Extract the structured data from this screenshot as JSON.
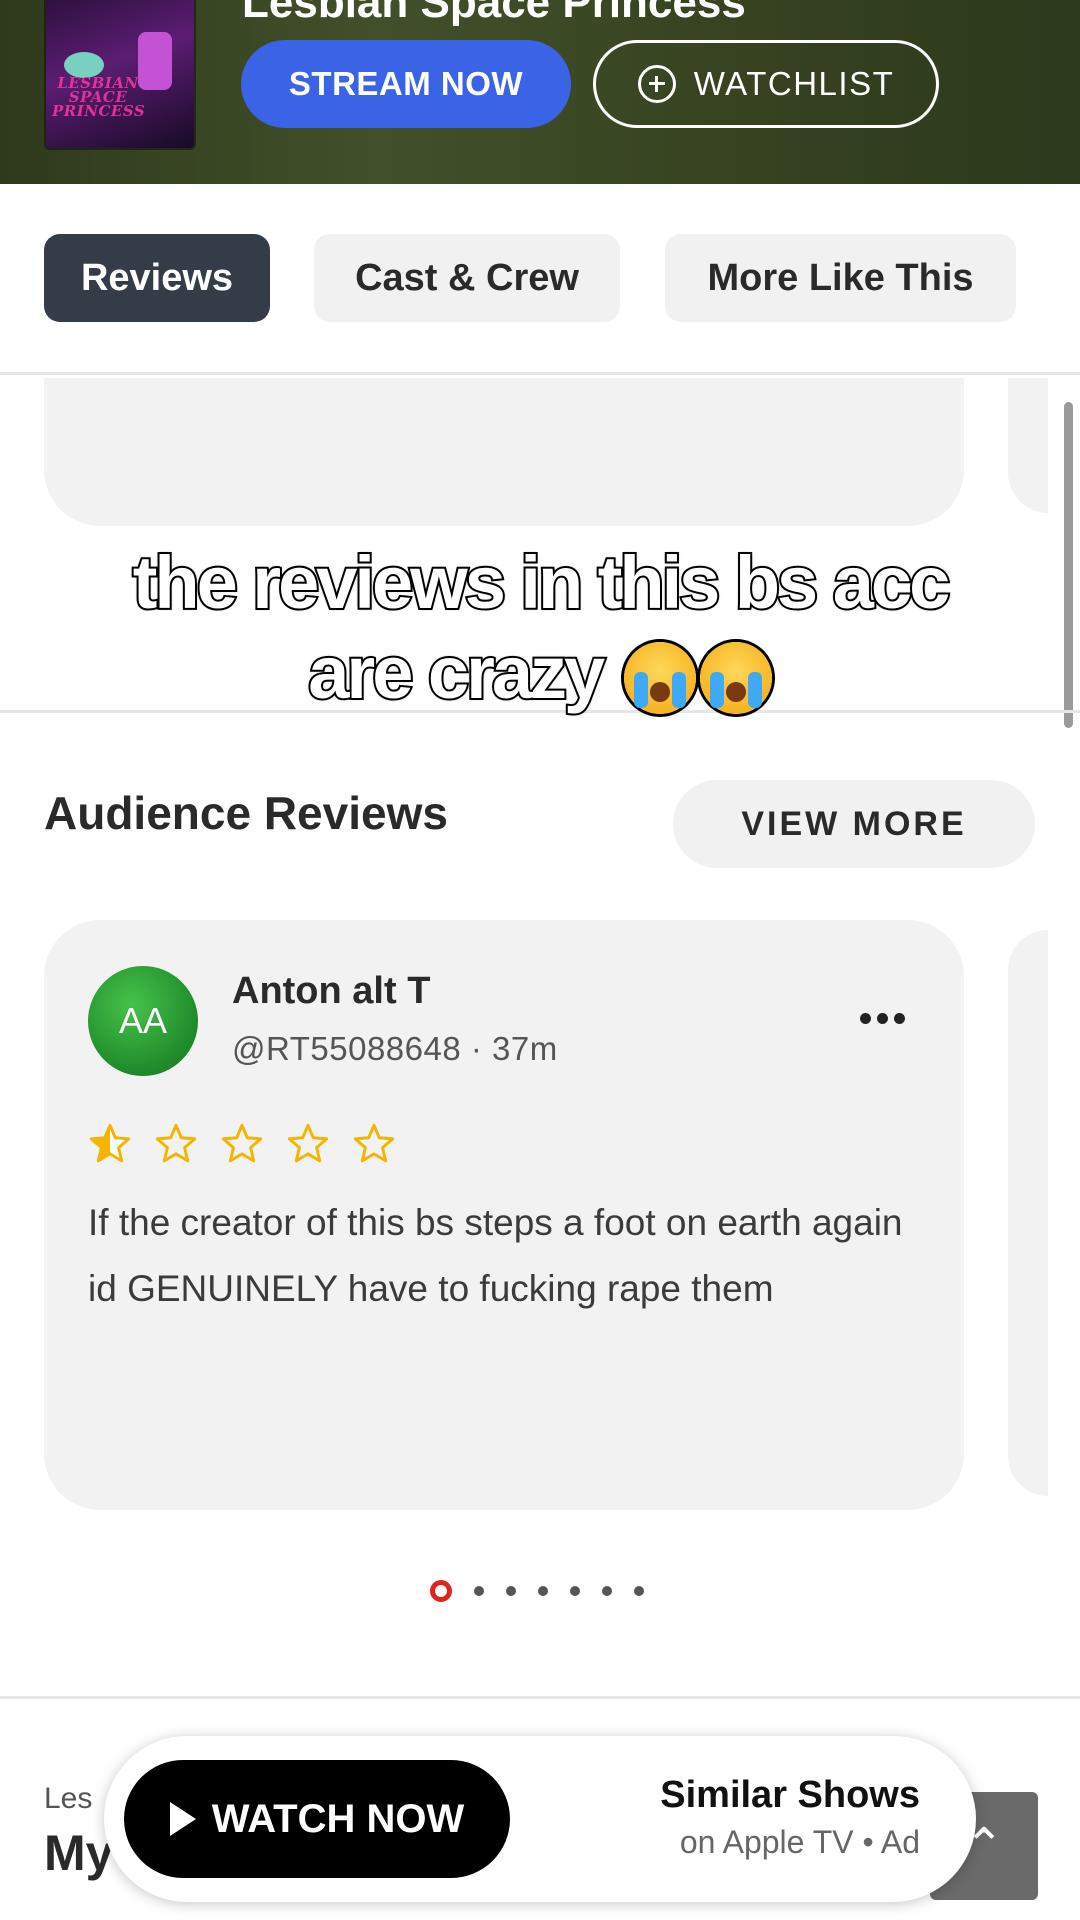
{
  "hero": {
    "title": "Lesbian Space Princess",
    "poster_text": [
      "LESBIAN",
      "SPACE",
      "PRINCESS"
    ],
    "stream_label": "STREAM NOW",
    "watchlist_label": "WATCHLIST"
  },
  "tabs": [
    {
      "label": "Reviews",
      "active": true
    },
    {
      "label": "Cast & Crew",
      "active": false
    },
    {
      "label": "More Like This",
      "active": false
    }
  ],
  "caption": {
    "line1": "the reviews in this bs acc",
    "line2": "are crazy"
  },
  "audience_reviews": {
    "title": "Audience Reviews",
    "view_more_label": "VIEW MORE",
    "review": {
      "avatar_initials": "AA",
      "name": "Anton alt T",
      "meta": "@RT55088648 · 37m",
      "rating": 0.5,
      "rating_max": 5,
      "text": "If the creator of this bs steps a foot on earth again id GENUINELY have to fucking rape them"
    },
    "pagination": {
      "count": 7,
      "active_index": 0
    }
  },
  "bottom": {
    "label": "Les",
    "title": "My"
  },
  "ad": {
    "watch_label": "WATCH NOW",
    "title": "Similar Shows",
    "subtitle": "on Apple TV • Ad"
  },
  "colors": {
    "accent": "#3a63e6",
    "tab_active": "#333c47",
    "star": "#f5b400",
    "dot_active": "#e0241b"
  },
  "icons": [
    "plus-circle-icon",
    "more-horizontal-icon",
    "star-icon",
    "play-icon",
    "chevron-up-icon",
    "loudly-crying-face-emoji"
  ]
}
